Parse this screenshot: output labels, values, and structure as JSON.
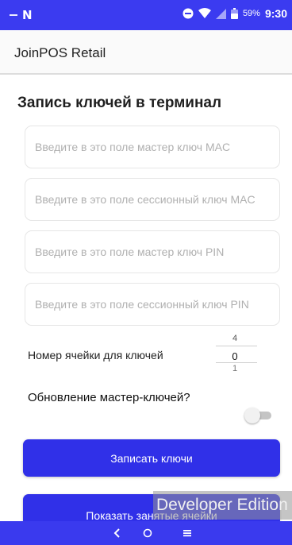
{
  "status_bar": {
    "battery_percent": "59%",
    "time": "9:30",
    "icons": [
      "notification-n-icon",
      "do-not-disturb-icon",
      "wifi-icon",
      "signal-icon",
      "battery-icon"
    ]
  },
  "app_bar": {
    "title": "JoinPOS Retail"
  },
  "main": {
    "section_title": "Запись ключей в терминал",
    "fields": [
      {
        "placeholder": "Введите в это поле мастер ключ MAC",
        "value": ""
      },
      {
        "placeholder": "Введите в это поле сессионный ключ MAC",
        "value": ""
      },
      {
        "placeholder": "Введите в это поле мастер ключ PIN",
        "value": ""
      },
      {
        "placeholder": "Введите в это поле сессионный ключ PIN",
        "value": ""
      }
    ],
    "cell_label": "Номер ячейки для ключей",
    "cell_picker": {
      "prev": "4",
      "selected": "0",
      "next": "1"
    },
    "toggle_label": "Обновление мастер-ключей?",
    "toggle_on": false,
    "write_button": "Записать ключи",
    "show_button": "Показать занятые ячейки"
  },
  "watermark": "Developer Edition",
  "colors": {
    "accent": "#3030e8",
    "status_bar": "#3b3bf0",
    "nav_bar": "#3a3aee"
  }
}
